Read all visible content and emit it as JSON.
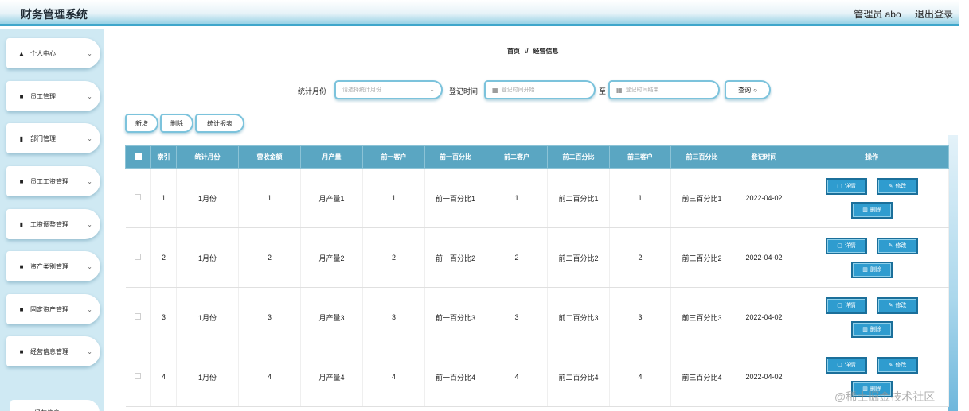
{
  "app": {
    "title": "财务管理系统",
    "user": "管理员 abo",
    "logout": "退出登录"
  },
  "sidebar": {
    "items": [
      {
        "icon": "user-icon",
        "glyph": "▲",
        "label": "个人中心"
      },
      {
        "icon": "grid-icon",
        "glyph": "■",
        "label": "员工管理"
      },
      {
        "icon": "bar-chart-icon",
        "glyph": "▮",
        "label": "部门管理"
      },
      {
        "icon": "grid-icon",
        "glyph": "■",
        "label": "员工工资管理"
      },
      {
        "icon": "clipboard-icon",
        "glyph": "▮",
        "label": "工资调整管理"
      },
      {
        "icon": "grid-icon",
        "glyph": "■",
        "label": "资产类别管理"
      },
      {
        "icon": "grid-icon",
        "glyph": "■",
        "label": "固定资产管理"
      },
      {
        "icon": "grid-icon",
        "glyph": "■",
        "label": "经营信息管理"
      }
    ],
    "sub_item": "经营信息"
  },
  "breadcrumb": {
    "home": "首页",
    "sep": "//",
    "current": "经营信息"
  },
  "search": {
    "month_label": "统计月份",
    "month_placeholder": "请选择统计月份",
    "time_label": "登记时间",
    "start_placeholder": "登记时间开始",
    "to": "至",
    "end_placeholder": "登记时间结束",
    "query": "查询"
  },
  "toolbar": {
    "add": "新增",
    "delete": "删除",
    "report": "统计报表"
  },
  "table": {
    "headers": [
      "索引",
      "统计月份",
      "营收金额",
      "月产量",
      "前一客户",
      "前一百分比",
      "前二客户",
      "前二百分比",
      "前三客户",
      "前三百分比",
      "登记时间",
      "操作"
    ],
    "rows": [
      {
        "index": "1",
        "month": "1月份",
        "revenue": "1",
        "output": "月产量1",
        "c1": "1",
        "p1": "前一百分比1",
        "c2": "1",
        "p2": "前二百分比1",
        "c3": "1",
        "p3": "前三百分比1",
        "time": "2022-04-02"
      },
      {
        "index": "2",
        "month": "1月份",
        "revenue": "2",
        "output": "月产量2",
        "c1": "2",
        "p1": "前一百分比2",
        "c2": "2",
        "p2": "前二百分比2",
        "c3": "2",
        "p3": "前三百分比2",
        "time": "2022-04-02"
      },
      {
        "index": "3",
        "month": "1月份",
        "revenue": "3",
        "output": "月产量3",
        "c1": "3",
        "p1": "前一百分比3",
        "c2": "3",
        "p2": "前二百分比3",
        "c3": "3",
        "p3": "前三百分比3",
        "time": "2022-04-02"
      },
      {
        "index": "4",
        "month": "1月份",
        "revenue": "4",
        "output": "月产量4",
        "c1": "4",
        "p1": "前一百分比4",
        "c2": "4",
        "p2": "前二百分比4",
        "c3": "4",
        "p3": "前三百分比4",
        "time": "2022-04-02"
      }
    ],
    "actions": {
      "detail": "详情",
      "edit": "修改",
      "delete": "删除"
    }
  },
  "watermark": "@稀土掘金技术社区"
}
